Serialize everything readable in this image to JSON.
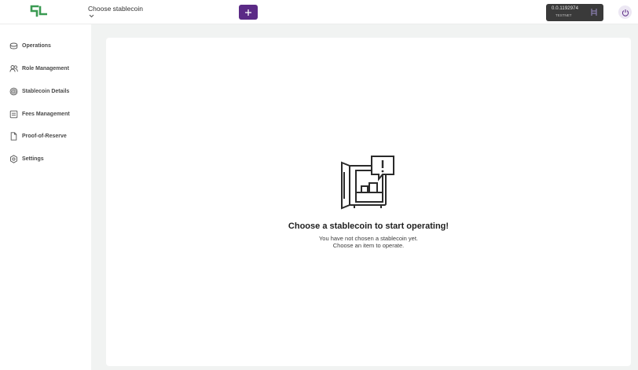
{
  "header": {
    "logo_icon": "stablecoin-studio-logo",
    "coin_selector": {
      "placeholder": "Choose stablecoin",
      "icon": "chevron-down-icon"
    },
    "add_button": {
      "icon": "plus-icon",
      "color": "#5b2a86"
    },
    "account": {
      "id": "0.0.1192974",
      "network": "TESTNET",
      "icon": "hashpack-wallet-icon"
    },
    "power_button": {
      "icon": "power-icon",
      "color": "#5b2a86"
    }
  },
  "sidebar": {
    "items": [
      {
        "label": "Operations",
        "icon": "coins-icon"
      },
      {
        "label": "Role Management",
        "icon": "users-icon"
      },
      {
        "label": "Stablecoin Details",
        "icon": "fingerprint-icon"
      },
      {
        "label": "Fees Management",
        "icon": "receipt-icon"
      },
      {
        "label": "Proof-of-Reserve",
        "icon": "document-icon"
      },
      {
        "label": "Settings",
        "icon": "gear-icon"
      }
    ]
  },
  "main": {
    "illustration_icon": "empty-safe-alert-icon",
    "title": "Choose a stablecoin to start operating!",
    "line1": "You have not chosen a stablecoin yet.",
    "line2": "Choose an item to operate."
  },
  "colors": {
    "accent": "#5b2a86",
    "logo_green": "#3a9a52",
    "main_background": "#f1f3f2",
    "account_box": "#3a3a3a"
  }
}
